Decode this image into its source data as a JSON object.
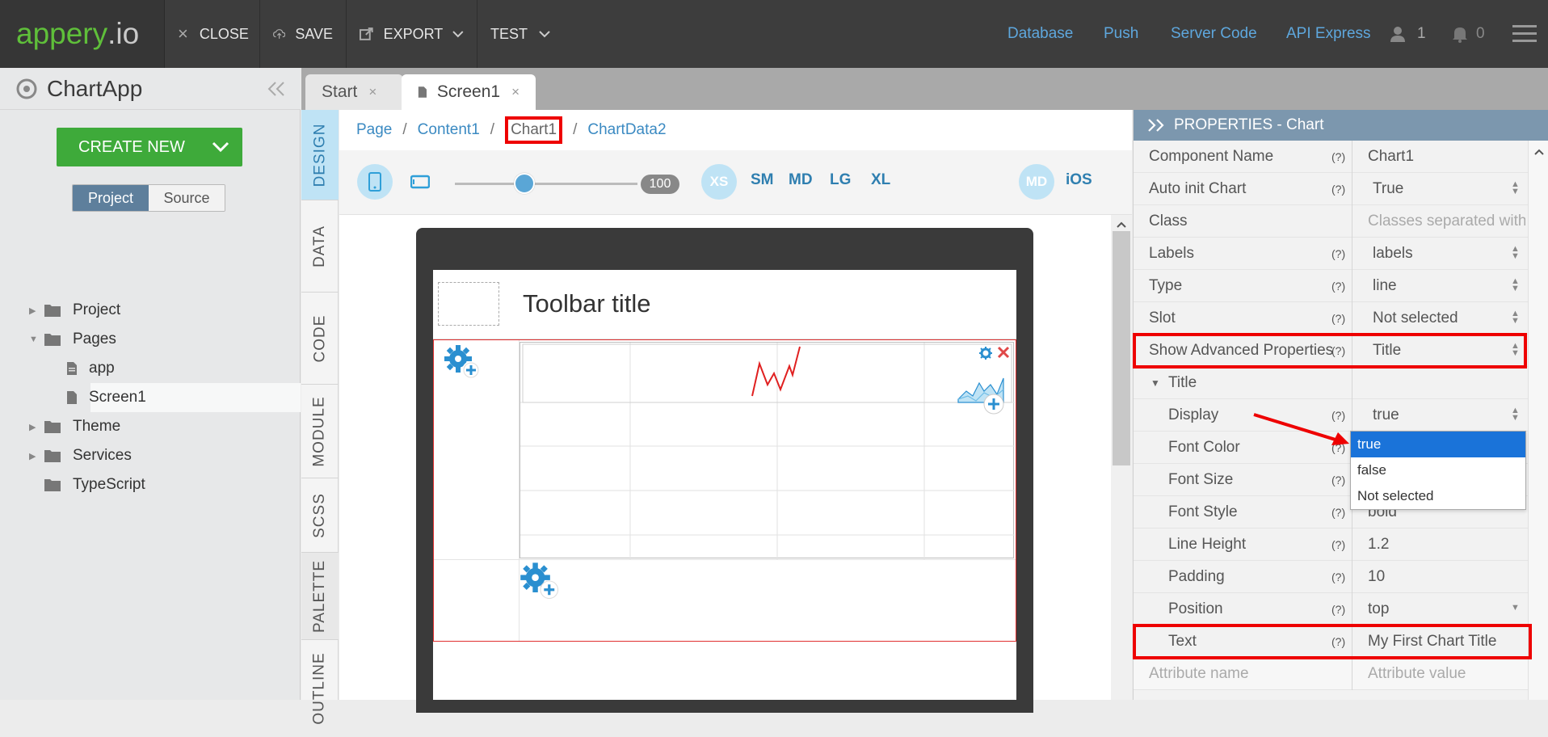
{
  "topbar": {
    "logo_main": "appery",
    "logo_suffix": ".io",
    "close_label": "CLOSE",
    "save_label": "SAVE",
    "export_label": "EXPORT",
    "test_label": "TEST",
    "links": [
      "Database",
      "Push",
      "Server Code",
      "API Express"
    ],
    "user_count": "1",
    "notif_count": "0"
  },
  "left": {
    "app_name": "ChartApp",
    "create_new": "CREATE NEW",
    "seg_project": "Project",
    "seg_source": "Source",
    "tree": {
      "project": "Project",
      "pages": "Pages",
      "app": "app",
      "screen1": "Screen1",
      "theme": "Theme",
      "services": "Services",
      "typescript": "TypeScript"
    }
  },
  "tabs": {
    "start": "Start",
    "screen1": "Screen1",
    "close_glyph": "×"
  },
  "side_tabs": [
    "DESIGN",
    "DATA",
    "CODE",
    "MODULE",
    "SCSS",
    "PALETTE",
    "OUTLINE"
  ],
  "designer": {
    "breadcrumb": [
      "Page",
      "Content1",
      "Chart1",
      "ChartData2"
    ],
    "zoom": "100",
    "zoom_fraction": 0.38,
    "breakpoints": [
      "XS",
      "SM",
      "MD",
      "LG",
      "XL"
    ],
    "theme_size": "MD",
    "theme_platform": "iOS",
    "toolbar_title": "Toolbar title"
  },
  "properties": {
    "header": "PROPERTIES - Chart",
    "help": "(?)",
    "rows": {
      "component_name": {
        "label": "Component Name",
        "value": "Chart1"
      },
      "auto_init": {
        "label": "Auto init Chart",
        "value": "True"
      },
      "class": {
        "label": "Class",
        "value": "Classes separated with"
      },
      "labels": {
        "label": "Labels",
        "value": "labels"
      },
      "type": {
        "label": "Type",
        "value": "line"
      },
      "slot": {
        "label": "Slot",
        "value": "Not selected"
      },
      "show_adv": {
        "label": "Show Advanced Properties",
        "value": "Title"
      },
      "title_group": {
        "label": "Title"
      },
      "display": {
        "label": "Display",
        "value": "true"
      },
      "font_color": {
        "label": "Font Color"
      },
      "font_size": {
        "label": "Font Size"
      },
      "font_style": {
        "label": "Font Style",
        "value": "bold"
      },
      "line_height": {
        "label": "Line Height",
        "value": "1.2"
      },
      "padding": {
        "label": "Padding",
        "value": "10"
      },
      "position": {
        "label": "Position",
        "value": "top"
      },
      "text": {
        "label": "Text",
        "value": "My First Chart Title"
      },
      "attr": {
        "label": "Attribute name",
        "value": "Attribute value"
      }
    },
    "dropdown_options": [
      "true",
      "false",
      "Not selected"
    ]
  },
  "colors": {
    "brand_green": "#5fbf3a",
    "link_blue": "#5ea7dd",
    "highlight_red": "#e00000",
    "selected_blue": "#1a73d9"
  }
}
